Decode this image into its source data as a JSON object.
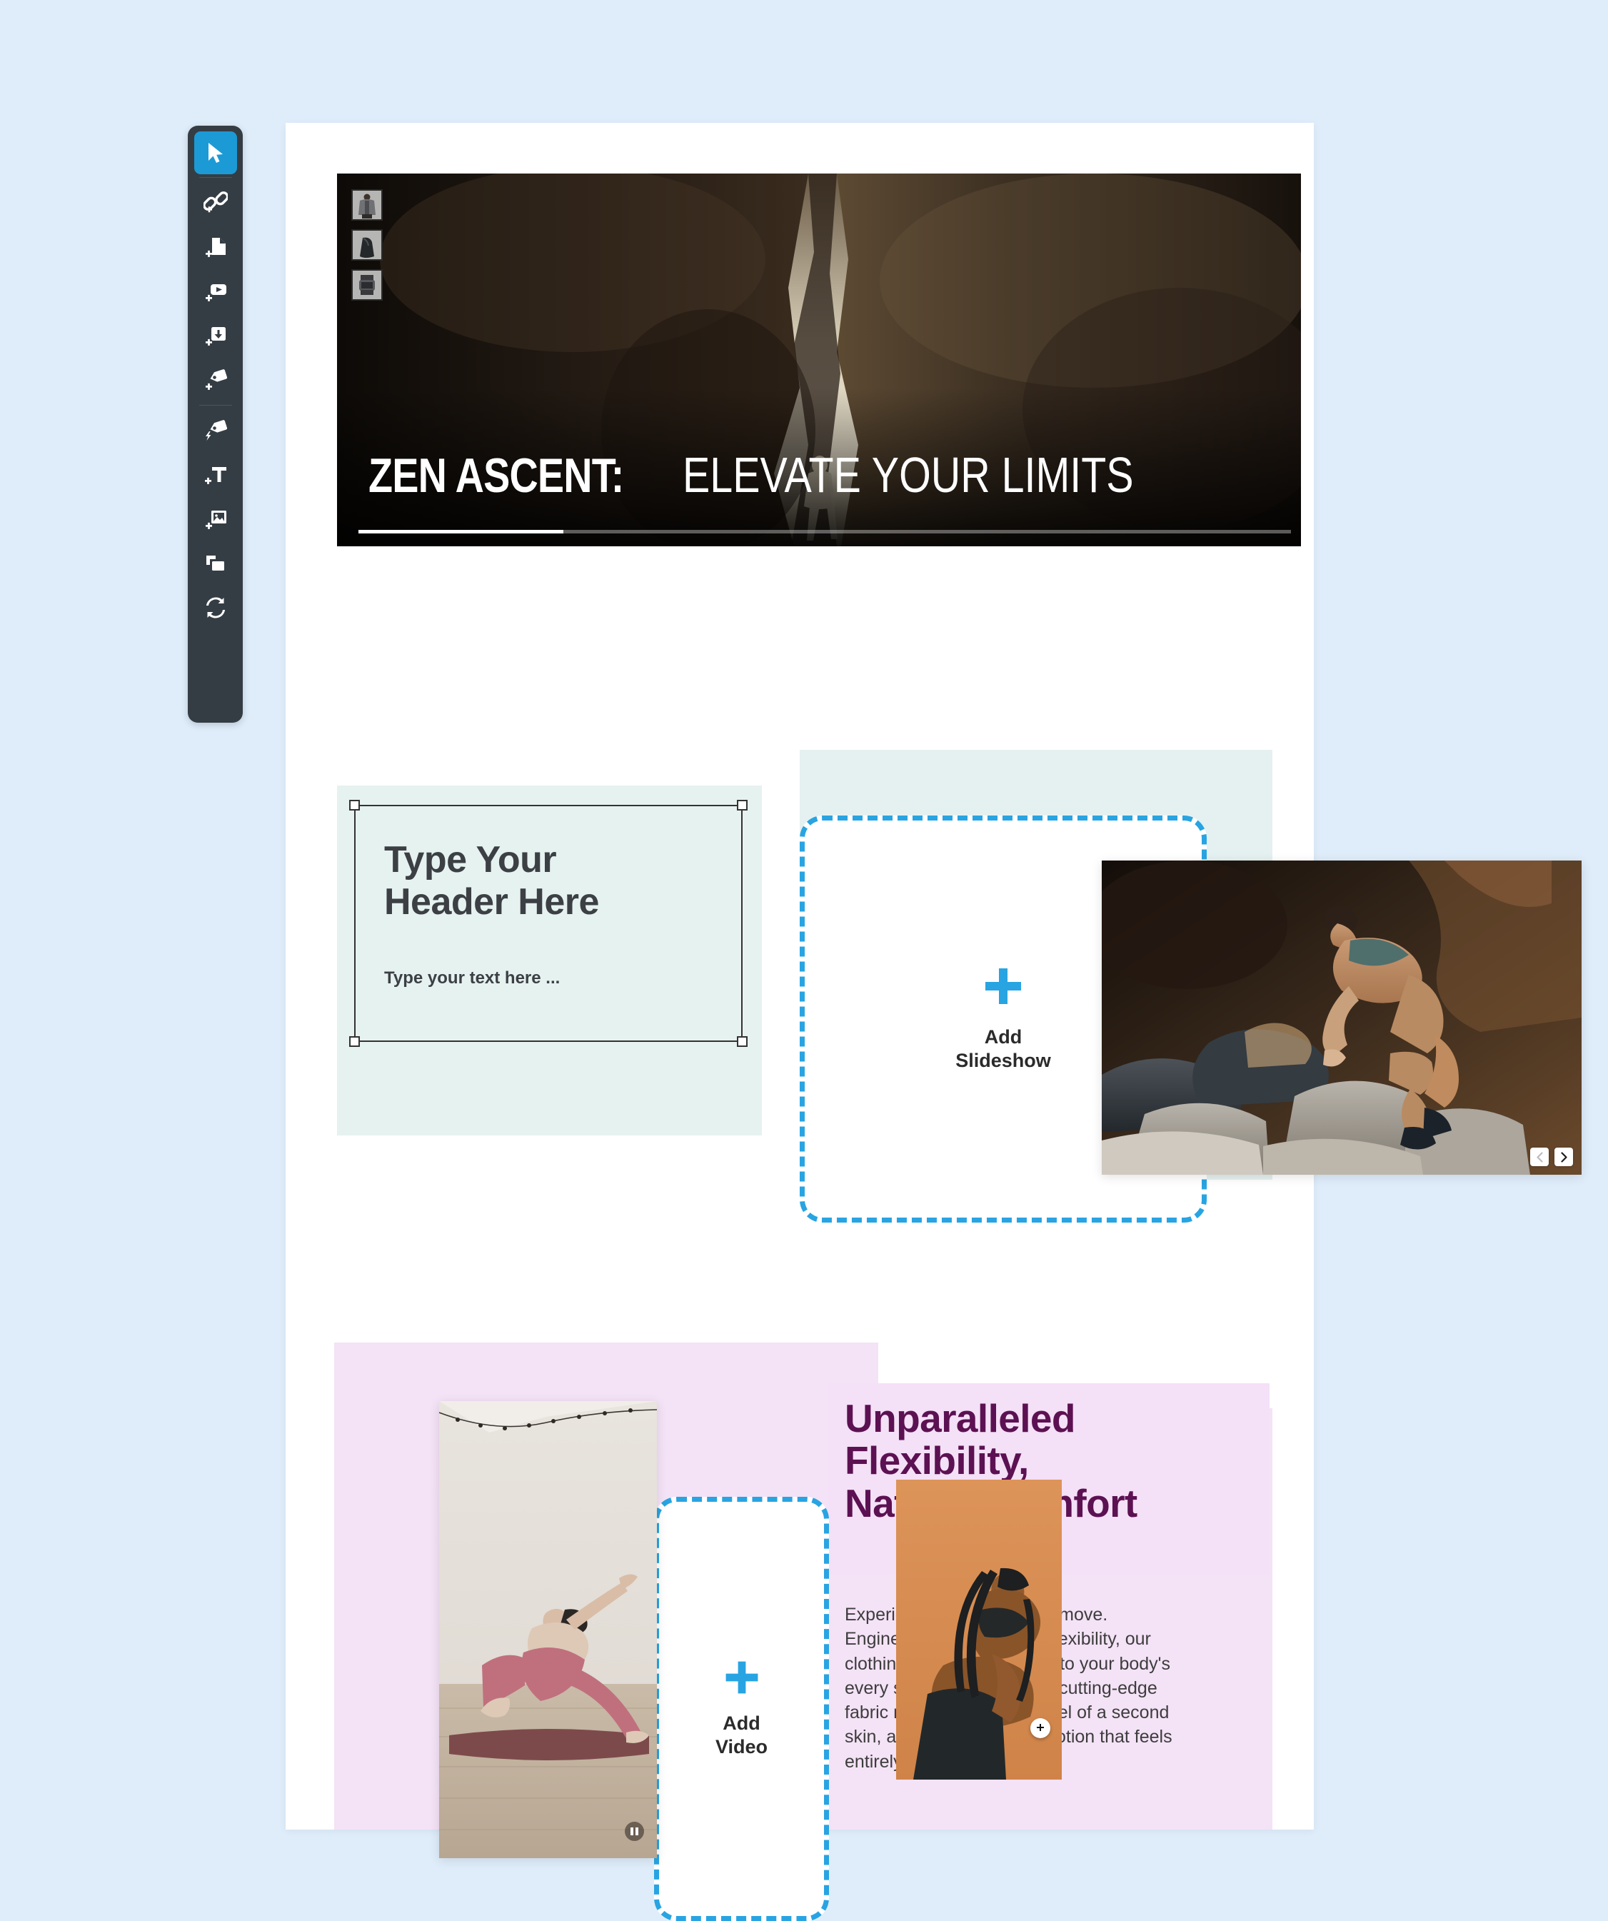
{
  "app": {
    "background_color": "#dfedfb",
    "accent_blue": "#28a4e2",
    "toolbar_bg": "#353d44"
  },
  "toolbar": {
    "name": "editor-toolbar",
    "tools": [
      {
        "id": "select",
        "icon": "cursor-arrow-icon",
        "label": "Select",
        "active": true
      },
      {
        "id": "add-link",
        "icon": "add-link-icon",
        "label": "Add Link",
        "active": false
      },
      {
        "id": "add-page",
        "icon": "add-page-icon",
        "label": "Add Page",
        "active": false
      },
      {
        "id": "add-video",
        "icon": "add-video-icon",
        "label": "Add Video",
        "active": false
      },
      {
        "id": "add-download",
        "icon": "add-download-icon",
        "label": "Add Download",
        "active": false
      },
      {
        "id": "add-tag",
        "icon": "add-tag-icon",
        "label": "Add Tag",
        "active": false
      },
      {
        "id": "hotspot-tag",
        "icon": "hotspot-tag-icon",
        "label": "Hotspot",
        "active": false
      },
      {
        "id": "add-text",
        "icon": "add-text-icon",
        "label": "Add Text",
        "active": false
      },
      {
        "id": "add-image",
        "icon": "add-image-icon",
        "label": "Add Image",
        "active": false
      },
      {
        "id": "duplicate",
        "icon": "duplicate-icon",
        "label": "Duplicate",
        "active": false
      },
      {
        "id": "replace",
        "icon": "refresh-replace-icon",
        "label": "Replace",
        "active": false
      }
    ]
  },
  "hero": {
    "title_bold": "ZEN ASCENT:",
    "title_light": "ELEVATE YOUR LIMITS",
    "progress_percent": 22,
    "products": [
      {
        "name": "hoodie-thumbnail"
      },
      {
        "name": "bag-thumbnail"
      },
      {
        "name": "watch-thumbnail"
      }
    ]
  },
  "text_block": {
    "heading": "Type Your Header Here",
    "body": "Type your text here ...",
    "selected": true
  },
  "slideshow_placeholder": {
    "label": "Add\nSlideshow",
    "line1": "Add",
    "line2": "Slideshow"
  },
  "video_placeholder": {
    "line1": "Add",
    "line2": "Video"
  },
  "slideshow_card": {
    "prev_label": "‹",
    "next_label": "›"
  },
  "feature": {
    "heading": "Unparalleled Flexibility, Natural Comfort",
    "heading_line1": "Unparalleled",
    "heading_line2": "Flexibility,",
    "heading_line3": "Natural Comfort",
    "body": "Experience the freedom to move. Engineered for maximum flexibility, our clothing effortlessly adapts to your body's every stretch and pose. Its cutting-edge fabric mimics the natural feel of a second skin, allowing a range of motion that feels entirely uninhibited.",
    "heading_color": "#5c1152",
    "band_color": "#f4e0f7"
  },
  "video_card": {
    "state": "playing"
  },
  "orange_card": {
    "hotspot": "+"
  }
}
